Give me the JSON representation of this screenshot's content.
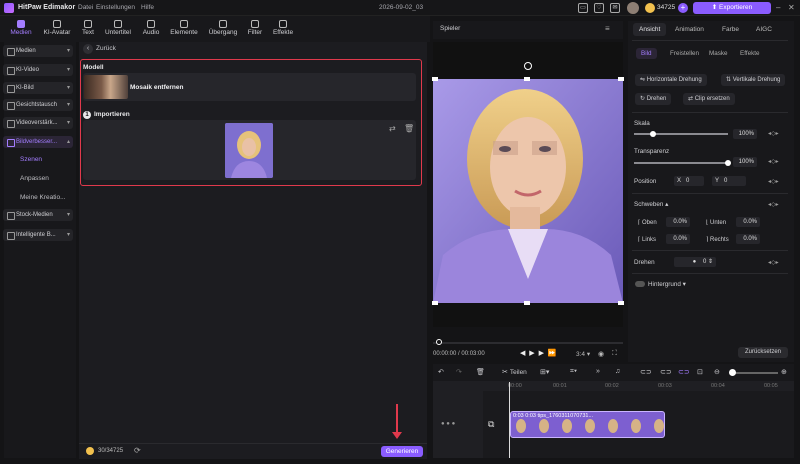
{
  "app": {
    "name": "HitPaw Edimakor",
    "menu": [
      "Datei",
      "Einstellungen",
      "Hilfe"
    ],
    "project": "2026-09-02_03",
    "credits": "34725",
    "export_label": "Exportieren"
  },
  "toolbar": [
    {
      "label": "Medien",
      "active": true
    },
    {
      "label": "KI-Avatar"
    },
    {
      "label": "Text"
    },
    {
      "label": "Untertitel"
    },
    {
      "label": "Audio"
    },
    {
      "label": "Elemente"
    },
    {
      "label": "Übergang"
    },
    {
      "label": "Filter"
    },
    {
      "label": "Effekte"
    }
  ],
  "sidebar": {
    "items": [
      "Medien",
      "KI-Video",
      "KI-Bild",
      "Gesichtstausch",
      "Videoverstärk...",
      "Bildverbesser...",
      "Stock-Medien",
      "Intelligente B..."
    ],
    "subitems": [
      "Szenen",
      "Anpassen",
      "Meine Kreatio..."
    ]
  },
  "panel": {
    "back": "Zurück",
    "model_label": "Modell",
    "model_name": "Mosaik entfernen",
    "import_num": "1",
    "import_label": "Importieren",
    "gen_credits": "30/34725",
    "generate": "Generieren"
  },
  "player": {
    "title": "Spieler",
    "time": "00:00:00 / 00:03:00",
    "ratio": "3:4"
  },
  "right": {
    "tabs": [
      "Ansicht",
      "Animation",
      "Farbe",
      "AIGC"
    ],
    "subtabs": [
      "Bild",
      "Freistellen",
      "Maske",
      "Effekte"
    ],
    "flip_h": "Horizontale Drehung",
    "flip_v": "Vertikale Drehung",
    "rotate": "Drehen",
    "replace": "Clip ersetzen",
    "scale_label": "Skala",
    "scale_value": "100%",
    "scale_level": 1.0,
    "opacity_label": "Transparenz",
    "opacity_value": "100%",
    "opacity_level": 1.0,
    "position_label": "Position",
    "pos_x_label": "X",
    "pos_x": "0",
    "pos_y_label": "Y",
    "pos_y": "0",
    "blend_label": "Schweben",
    "edges": [
      {
        "label": "Oben",
        "value": "0.0%"
      },
      {
        "label": "Unten",
        "value": "0.0%"
      },
      {
        "label": "Links",
        "value": "0.0%"
      },
      {
        "label": "Rechts",
        "value": "0.0%"
      }
    ],
    "rotate_label": "Drehen",
    "rotate_value": "0",
    "background_label": "Hintergrund",
    "reset": "Zurücksetzen"
  },
  "timeline": {
    "split": "Teilen",
    "ruler": [
      "00:00",
      "00:01",
      "00:02",
      "00:03",
      "00:04",
      "00:05"
    ],
    "clip_label": "0:03  0:03 tips_1760311070731..."
  }
}
